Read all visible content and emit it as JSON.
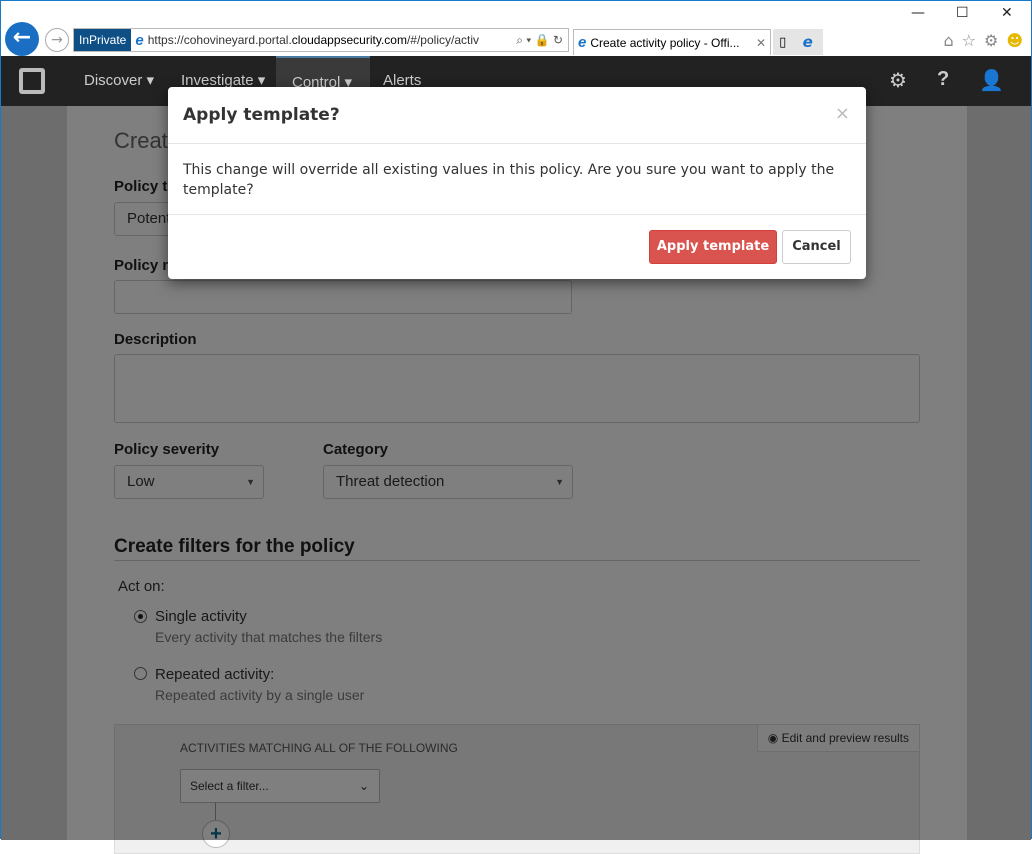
{
  "browser": {
    "inprivate": "InPrivate",
    "url_pre": "https://cohovineyard.portal.",
    "url_domain": "cloudappsecurity.com",
    "url_post": "/#/policy/activ",
    "tab_title": "Create activity policy - Offi..."
  },
  "nav": {
    "items": [
      "Discover ▾",
      "Investigate ▾",
      "Control ▾",
      "Alerts"
    ],
    "active": "Control"
  },
  "page": {
    "title": "Create",
    "policy_template_label": "Policy t",
    "policy_template_value": "Potent",
    "policy_name_label": "Policy n",
    "description_label": "Description",
    "severity_label": "Policy severity",
    "severity_value": "Low",
    "category_label": "Category",
    "category_value": "Threat detection",
    "filters_heading": "Create filters for the policy",
    "act_on": "Act on:",
    "single_label": "Single activity",
    "single_desc": "Every activity that matches the filters",
    "repeated_label": "Repeated activity:",
    "repeated_desc": "Repeated activity by a single user",
    "act_on_selected": "Single activity",
    "matching_heading": "ACTIVITIES MATCHING ALL OF THE FOLLOWING",
    "edit_preview": "Edit and preview results",
    "select_filter": "Select a filter..."
  },
  "modal": {
    "title": "Apply template?",
    "body": "This change will override all existing values in this policy. Are you sure you want to apply the template?",
    "apply": "Apply template",
    "cancel": "Cancel",
    "close": "×"
  },
  "colors": {
    "apply": "#d9534f",
    "accent": "#1a6fc4"
  }
}
